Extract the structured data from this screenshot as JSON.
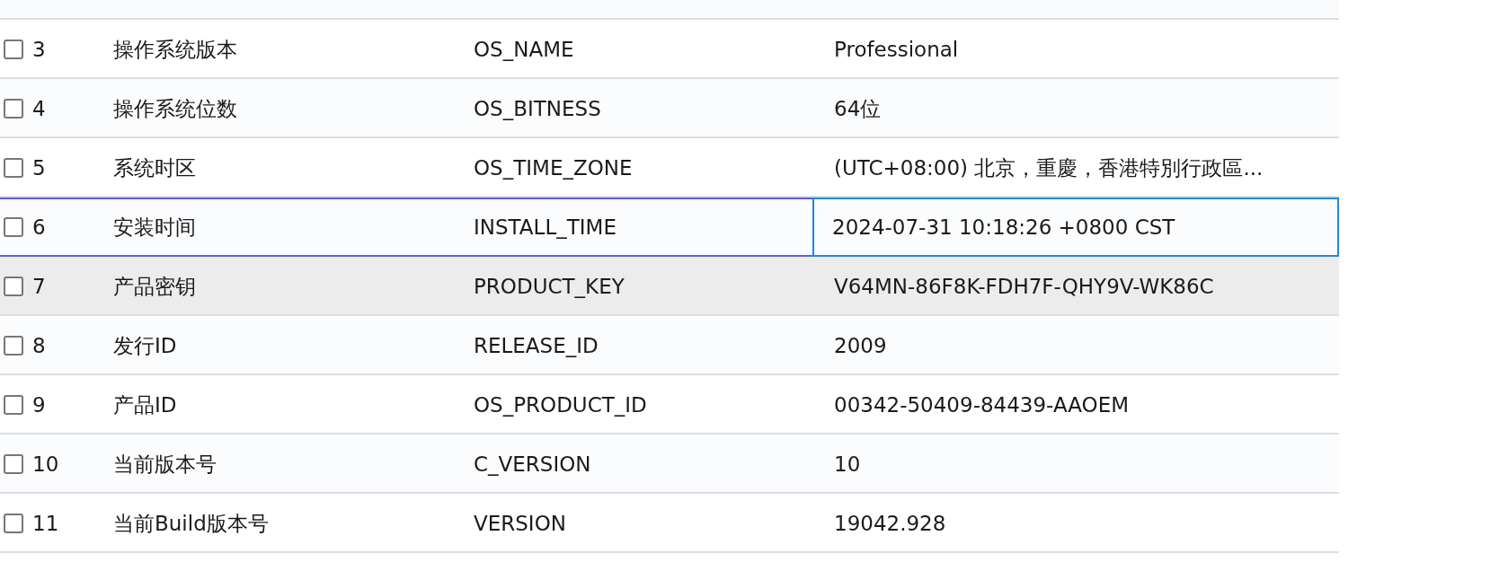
{
  "table": {
    "rows": [
      {
        "number": "3",
        "name": "操作系统版本",
        "key": "OS_NAME",
        "value": "Professional",
        "checked": false,
        "selected": false,
        "hovered": false
      },
      {
        "number": "4",
        "name": "操作系统位数",
        "key": "OS_BITNESS",
        "value": "64位",
        "checked": false,
        "selected": false,
        "hovered": false
      },
      {
        "number": "5",
        "name": "系统时区",
        "key": "OS_TIME_ZONE",
        "value": "(UTC+08:00) 北京，重慶，香港特別行政區...",
        "checked": false,
        "selected": false,
        "hovered": false
      },
      {
        "number": "6",
        "name": "安装时间",
        "key": "INSTALL_TIME",
        "value": "2024-07-31 10:18:26 +0800 CST",
        "checked": false,
        "selected": true,
        "hovered": false
      },
      {
        "number": "7",
        "name": "产品密钥",
        "key": "PRODUCT_KEY",
        "value": "V64MN-86F8K-FDH7F-QHY9V-WK86C",
        "checked": false,
        "selected": false,
        "hovered": true
      },
      {
        "number": "8",
        "name": "发行ID",
        "key": "RELEASE_ID",
        "value": "2009",
        "checked": false,
        "selected": false,
        "hovered": false
      },
      {
        "number": "9",
        "name": "产品ID",
        "key": "OS_PRODUCT_ID",
        "value": "00342-50409-84439-AAOEM",
        "checked": false,
        "selected": false,
        "hovered": false
      },
      {
        "number": "10",
        "name": "当前版本号",
        "key": "C_VERSION",
        "value": "10",
        "checked": false,
        "selected": false,
        "hovered": false
      },
      {
        "number": "11",
        "name": "当前Build版本号",
        "key": "VERSION",
        "value": "19042.928",
        "checked": false,
        "selected": false,
        "hovered": false
      }
    ]
  }
}
